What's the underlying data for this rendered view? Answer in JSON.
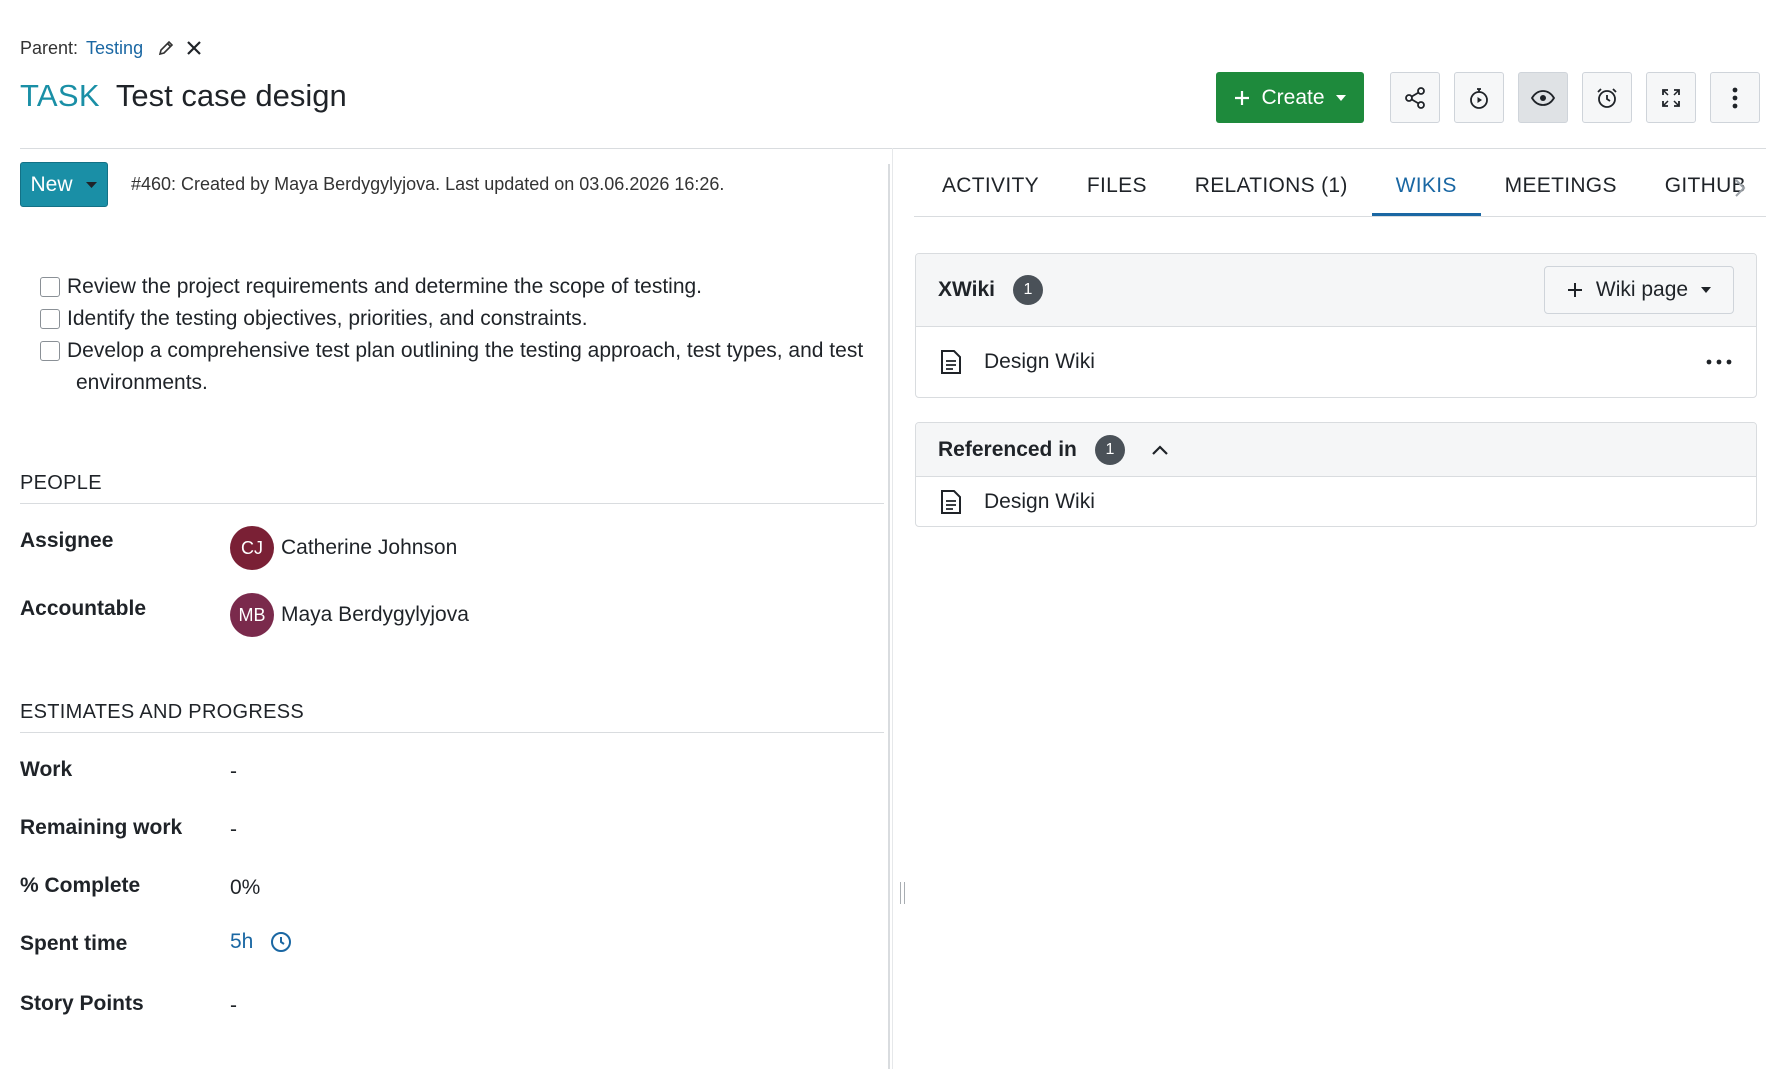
{
  "parent": {
    "label": "Parent:",
    "link": "Testing"
  },
  "title": {
    "type": "TASK",
    "subject": "Test case design"
  },
  "toolbar": {
    "create_label": "Create"
  },
  "status": {
    "label": "New",
    "meta": "#460: Created by Maya Berdygylyjova. Last updated on 03.06.2026 16:26."
  },
  "checklist": [
    {
      "text": "Review the project requirements and determine the scope of testing.",
      "checked": false
    },
    {
      "text": "Identify the testing objectives, priorities, and constraints.",
      "checked": false
    },
    {
      "text": "Develop a comprehensive test plan outlining the testing approach, test types, and test",
      "cont": "environments.",
      "checked": false
    }
  ],
  "people": {
    "section_title": "PEOPLE",
    "assignee_label": "Assignee",
    "assignee_initials": "CJ",
    "assignee_name": "Catherine Johnson",
    "accountable_label": "Accountable",
    "accountable_initials": "MB",
    "accountable_name": "Maya Berdygylyjova"
  },
  "estimates": {
    "section_title": "ESTIMATES AND PROGRESS",
    "work_label": "Work",
    "work_value": "-",
    "remaining_label": "Remaining work",
    "remaining_value": "-",
    "complete_label": "% Complete",
    "complete_value": "0%",
    "spent_label": "Spent time",
    "spent_value": "5h",
    "story_label": "Story Points",
    "story_value": "-"
  },
  "tabs": [
    {
      "label": "ACTIVITY",
      "active": false
    },
    {
      "label": "FILES",
      "active": false
    },
    {
      "label": "RELATIONS (1)",
      "active": false
    },
    {
      "label": "WIKIS",
      "active": true
    },
    {
      "label": "MEETINGS",
      "active": false
    },
    {
      "label": "GITHUB",
      "active": false
    }
  ],
  "xwiki": {
    "title": "XWiki",
    "count": "1",
    "add_label": "Wiki page",
    "items": [
      "Design Wiki"
    ]
  },
  "referenced": {
    "title": "Referenced in",
    "count": "1",
    "items": [
      "Design Wiki"
    ]
  },
  "colors": {
    "accent": "#1a8fa6",
    "link": "#1a67a3",
    "create": "#1e8a3c"
  }
}
